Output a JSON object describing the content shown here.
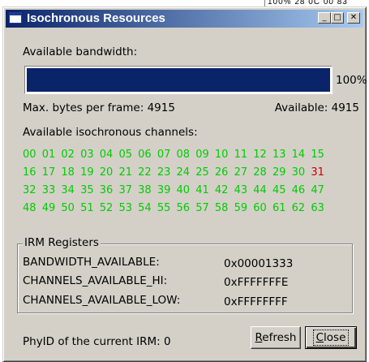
{
  "background_text": "100% 28   0C 00 83",
  "window": {
    "title": "Isochronous Resources",
    "controls": {
      "minimize": "_",
      "maximize": "□",
      "close": "✕"
    }
  },
  "bandwidth": {
    "label": "Available bandwidth:",
    "fill_fraction": 1.0,
    "percent_text": "100%",
    "max_bytes_label": "Max. bytes per frame: 4915",
    "available_label": "Available: 4915",
    "fill_color": "#0a246a"
  },
  "channels": {
    "label": "Available isochronous channels:",
    "free_color": "#00cc00",
    "used_color": "#cc0000",
    "rows": [
      [
        "00",
        "01",
        "02",
        "03",
        "04",
        "05",
        "06",
        "07",
        "08",
        "09",
        "10",
        "11",
        "12",
        "13",
        "14",
        "15"
      ],
      [
        "16",
        "17",
        "18",
        "19",
        "20",
        "21",
        "22",
        "23",
        "24",
        "25",
        "26",
        "27",
        "28",
        "29",
        "30",
        "31"
      ],
      [
        "32",
        "33",
        "34",
        "35",
        "36",
        "37",
        "38",
        "39",
        "40",
        "41",
        "42",
        "43",
        "44",
        "45",
        "46",
        "47"
      ],
      [
        "48",
        "49",
        "50",
        "51",
        "52",
        "53",
        "54",
        "55",
        "56",
        "57",
        "58",
        "59",
        "60",
        "61",
        "62",
        "63"
      ]
    ],
    "used": [
      "31"
    ]
  },
  "irm": {
    "legend": "IRM Registers",
    "registers": [
      {
        "name": "BANDWIDTH_AVAILABLE:",
        "value": "0x00001333"
      },
      {
        "name": "CHANNELS_AVAILABLE_HI:",
        "value": "0xFFFFFFFE"
      },
      {
        "name": "CHANNELS_AVAILABLE_LOW:",
        "value": "0xFFFFFFFF"
      }
    ]
  },
  "footer": {
    "phyid_label": "PhyID of the current IRM: 0",
    "refresh_label": "Refresh",
    "close_label": "Close"
  }
}
